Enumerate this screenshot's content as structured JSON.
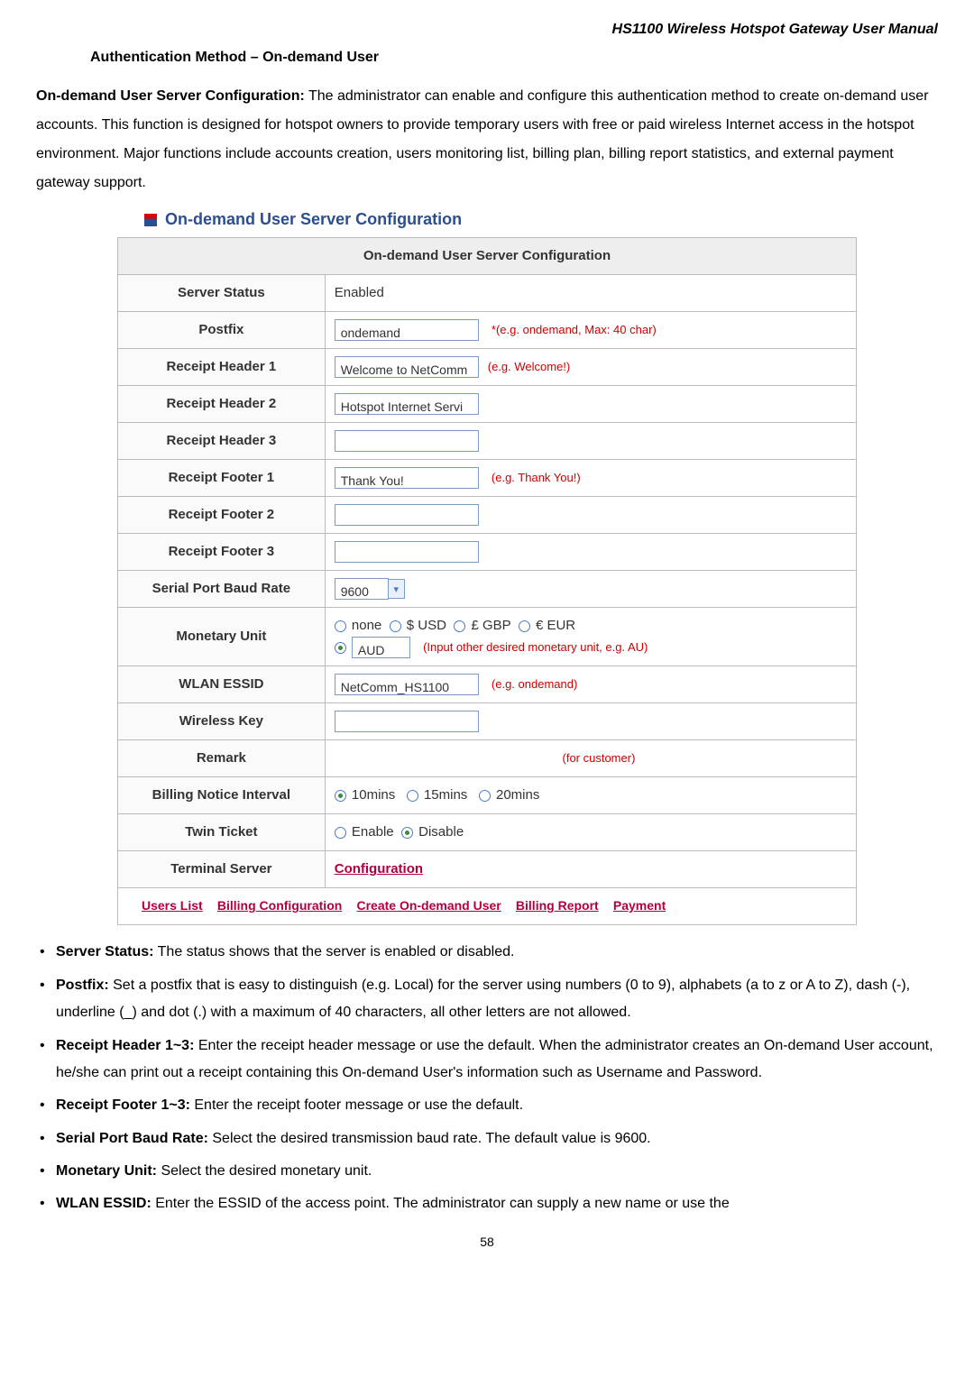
{
  "product_title": "HS1100  Wireless  Hotspot  Gateway  User  Manual",
  "section_heading": "Authentication Method – On-demand User",
  "intro": {
    "lead_bold": "On-demand User Server Configuration:",
    "lead_text": " The administrator can enable and configure this authentication method to create on-demand user accounts. This function is designed for hotspot owners to provide temporary users with free or paid wireless Internet access in the hotspot environment. Major functions include accounts creation, users monitoring list, billing plan, billing report statistics, and external payment gateway support."
  },
  "config_title": "On-demand User Server Configuration",
  "table_header": "On-demand User Server Configuration",
  "rows": {
    "server_status": {
      "label": "Server Status",
      "value": "Enabled"
    },
    "postfix": {
      "label": "Postfix",
      "value": "ondemand",
      "hint": "*(e.g. ondemand, Max: 40 char)"
    },
    "rh1": {
      "label": "Receipt Header 1",
      "value": "Welcome to NetComm",
      "hint": "(e.g. Welcome!)"
    },
    "rh2": {
      "label": "Receipt Header 2",
      "value": "Hotspot Internet Servi"
    },
    "rh3": {
      "label": "Receipt Header 3",
      "value": ""
    },
    "rf1": {
      "label": "Receipt Footer 1",
      "value": "Thank You!",
      "hint": "(e.g. Thank You!)"
    },
    "rf2": {
      "label": "Receipt Footer 2",
      "value": ""
    },
    "rf3": {
      "label": "Receipt Footer 3",
      "value": ""
    },
    "baud": {
      "label": "Serial Port Baud Rate",
      "value": "9600"
    },
    "monetary": {
      "label": "Monetary Unit",
      "opts": {
        "none": "none",
        "usd": "$ USD",
        "gbp": "£ GBP",
        "eur": "€ EUR"
      },
      "custom": "AUD",
      "hint": "(Input other desired monetary unit, e.g. AU)"
    },
    "essid": {
      "label": "WLAN ESSID",
      "value": "NetComm_HS1100",
      "hint": "(e.g. ondemand)"
    },
    "wkey": {
      "label": "Wireless Key",
      "value": ""
    },
    "remark": {
      "label": "Remark",
      "value": "",
      "hint": "(for customer)"
    },
    "billing_interval": {
      "label": "Billing Notice Interval",
      "o1": "10mins",
      "o2": "15mins",
      "o3": "20mins"
    },
    "twin": {
      "label": "Twin Ticket",
      "enable": "Enable",
      "disable": "Disable"
    },
    "terminal": {
      "label": "Terminal Server",
      "link": "Configuration"
    }
  },
  "links": {
    "l1": "Users List",
    "l2": "Billing Configuration",
    "l3": "Create On-demand User",
    "l4": "Billing Report",
    "l5": "Payment"
  },
  "bullets": {
    "b1": {
      "bold": "Server Status:",
      "text": " The status shows that the server is enabled or disabled."
    },
    "b2": {
      "bold": "Postfix:",
      "text": " Set a postfix that is easy to distinguish (e.g. Local) for the server using numbers (0 to 9), alphabets (a to z or A to Z), dash (-), underline (_) and dot (.) with a maximum of 40 characters, all other letters are not allowed."
    },
    "b3": {
      "bold": "Receipt Header 1~3:",
      "text": " Enter the receipt header message or use the default. When the administrator creates an On-demand User account, he/she can print out a receipt containing this On-demand User's information such as Username and Password."
    },
    "b4": {
      "bold": "Receipt Footer 1~3:",
      "text": " Enter the receipt footer message or use the default."
    },
    "b5": {
      "bold": "Serial Port Baud Rate:",
      "text": " Select the desired transmission baud rate. The default value is 9600."
    },
    "b6": {
      "bold": "Monetary Unit:",
      "text": " Select the desired monetary unit."
    },
    "b7": {
      "bold": "WLAN ESSID:",
      "text": " Enter the ESSID of the access point. The administrator can supply a new name or use the"
    }
  },
  "page_number": "58"
}
